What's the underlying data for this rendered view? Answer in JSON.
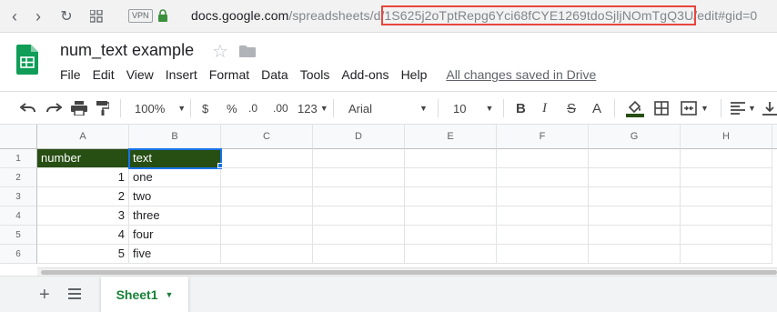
{
  "browser": {
    "url_domain": "docs.google.com",
    "url_path_prefix": "/spreadsheets/d/",
    "url_id": "1S625j2oTptRepg6Yci68fCYE1269tdoSjljNOmTgQ3U",
    "url_suffix": "/edit#gid=0",
    "vpn_label": "VPN"
  },
  "doc": {
    "title": "num_text example",
    "menu": [
      "File",
      "Edit",
      "View",
      "Insert",
      "Format",
      "Data",
      "Tools",
      "Add-ons",
      "Help"
    ],
    "saved_status": "All changes saved in Drive"
  },
  "toolbar": {
    "zoom": "100%",
    "currency": "$",
    "percent": "%",
    "dec_decrease": ".0",
    "dec_increase": ".00",
    "more_formats": "123",
    "font": "Arial",
    "font_size": "10",
    "bold": "B",
    "italic": "I",
    "strike": "S",
    "text_color": "A"
  },
  "grid": {
    "columns": [
      "A",
      "B",
      "C",
      "D",
      "E",
      "F",
      "G",
      "H"
    ],
    "rows": [
      "1",
      "2",
      "3",
      "4",
      "5",
      "6"
    ],
    "headers": [
      "number",
      "text"
    ],
    "data": [
      [
        "1",
        "one"
      ],
      [
        "2",
        "two"
      ],
      [
        "3",
        "three"
      ],
      [
        "4",
        "four"
      ],
      [
        "5",
        "five"
      ]
    ],
    "header_color": "#274e13"
  },
  "sheets": {
    "active_tab": "Sheet1"
  },
  "colors": {
    "accent_green": "#188038",
    "selection_blue": "#1a73e8",
    "highlight_red": "#e8453c"
  }
}
